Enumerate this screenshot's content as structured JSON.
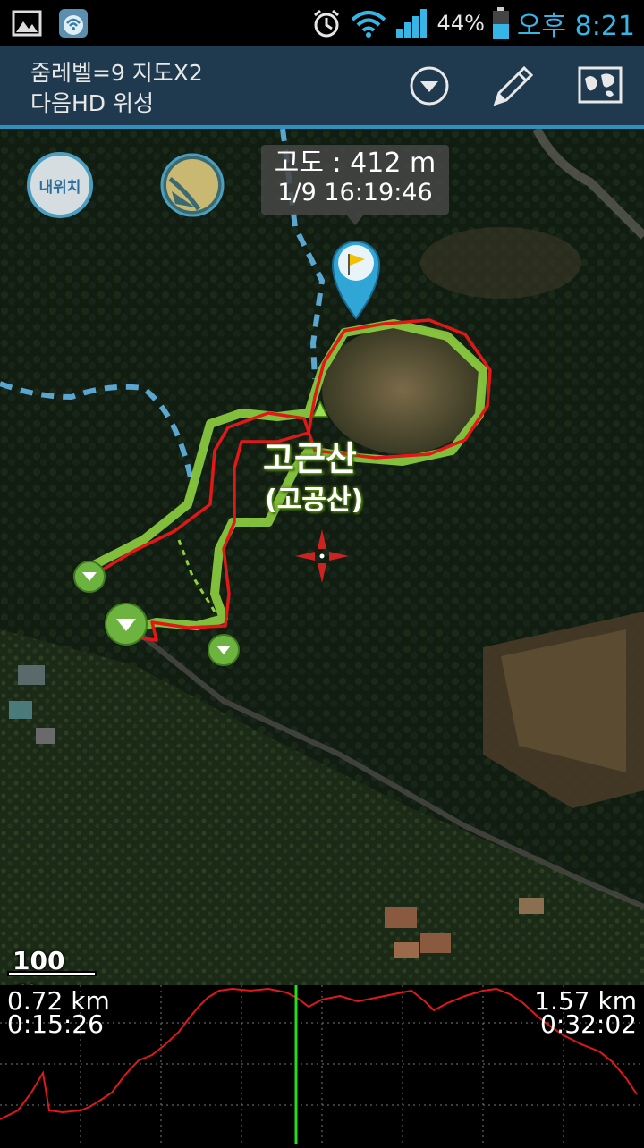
{
  "status_bar": {
    "icons": [
      "gallery-icon",
      "wifi-app-icon",
      "alarm-icon",
      "wifi-icon",
      "signal-icon",
      "battery-icon"
    ],
    "battery": "44%",
    "time": "오후 8:21"
  },
  "title_bar": {
    "line1": "줌레벨=9 지도X2",
    "line2": "다음HD 위성",
    "actions": [
      "dropdown-icon",
      "pencil-icon",
      "map-icon"
    ]
  },
  "map": {
    "my_location_label": "내위치",
    "tooltip": {
      "altitude": "고도 : 412 m",
      "time": "1/9 16:19:46"
    },
    "place_name": "고근산",
    "place_name_alt": "(고공산)",
    "scale_label": "100 m",
    "colors": {
      "track": "#e01818",
      "route": "#8ed040",
      "trail": "#5aa6d0",
      "marker": "#6db33f",
      "pin": "#2fa6d6"
    }
  },
  "profile": {
    "distance_left": "0.72 km",
    "time_left": "0:15:26",
    "distance_right": "1.57 km",
    "time_right": "0:32:02",
    "cursor_fraction": 0.46,
    "colors": {
      "line": "#e01818",
      "cursor": "#22dd22"
    }
  }
}
